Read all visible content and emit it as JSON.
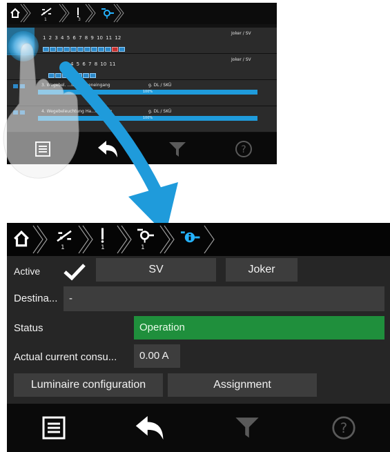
{
  "colors": {
    "accent": "#1f9bdb",
    "status_ok": "#1f8f3c",
    "panel_bg": "#262626",
    "button_bg": "#3d3d3d"
  },
  "top_screen": {
    "breadcrumb": {
      "icons": [
        "home-icon",
        "luminaire-group-icon",
        "line-icon",
        "luminaire-icon"
      ],
      "numbers": [
        "1",
        "3"
      ]
    },
    "rows": [
      {
        "right_label": "Joker / SV",
        "numbers": "1 2 3 4 5 6 7 8 9 10 11 12",
        "luminaire_states": [
          "ok",
          "ok",
          "ok",
          "ok",
          "ok",
          "ok",
          "ok",
          "ok",
          "ok",
          "ok",
          "error",
          "ok"
        ]
      },
      {
        "right_label": "Joker / SV",
        "numbers": "4 5 6 7 8 10 11",
        "luminaire_states": [
          "ok",
          "ok",
          "ok",
          "ok",
          "ok",
          "ok",
          "ok"
        ]
      },
      {
        "name": "3. Wegebel. ...latz Nebeneingang",
        "type": "g. DL / SKÜ",
        "progress": 100,
        "progress_label": "100%"
      },
      {
        "name": "4. Wegebeleuchtung Ha...eingang",
        "type": "g. DL / SKÜ",
        "progress": 100,
        "progress_label": "100%"
      }
    ],
    "toolbar": {
      "icons": [
        "list-icon",
        "back-icon",
        "filter-icon",
        "help-icon"
      ]
    }
  },
  "bottom_screen": {
    "breadcrumb": {
      "icons": [
        "home-icon",
        "luminaire-group-icon",
        "line-icon",
        "luminaire-icon",
        "luminaire-info-icon"
      ],
      "numbers": [
        "1",
        "1",
        "1"
      ]
    },
    "active": {
      "label": "Active",
      "checked": true,
      "buttons": [
        "SV",
        "Joker"
      ]
    },
    "destination": {
      "label": "Destina...",
      "value": "-"
    },
    "status": {
      "label": "Status",
      "value": "Operation"
    },
    "current": {
      "label": "Actual current consu...",
      "value": "0.00 A"
    },
    "actions": {
      "luminaire_config": "Luminaire configuration",
      "assignment": "Assignment"
    },
    "toolbar": {
      "icons": [
        "list-icon",
        "back-icon",
        "filter-icon",
        "help-icon"
      ]
    }
  }
}
